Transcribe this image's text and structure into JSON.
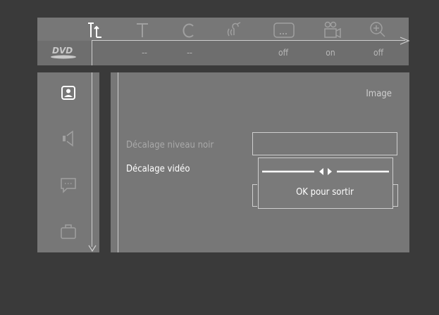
{
  "toolbar": {
    "icons": [
      "setup-icon",
      "title-icon",
      "chapter-icon",
      "audio-icon",
      "subtitle-icon",
      "angle-icon",
      "zoom-icon"
    ],
    "statuses": [
      "--",
      "--",
      "off",
      "on",
      "off"
    ]
  },
  "sidebar": {
    "icons": [
      "picture-icon",
      "speaker-icon",
      "speech-bubble-icon",
      "briefcase-icon"
    ]
  },
  "panel": {
    "title": "Image",
    "options": [
      "Décalage niveau noir",
      "Décalage vidéo"
    ],
    "ok_label": "OK pour sortir"
  },
  "colors": {
    "background": "#3a3a3a",
    "panel": "#777777",
    "line": "#cfcfcf",
    "text_dim": "#a9a9a9",
    "text_bright": "#ffffff"
  }
}
